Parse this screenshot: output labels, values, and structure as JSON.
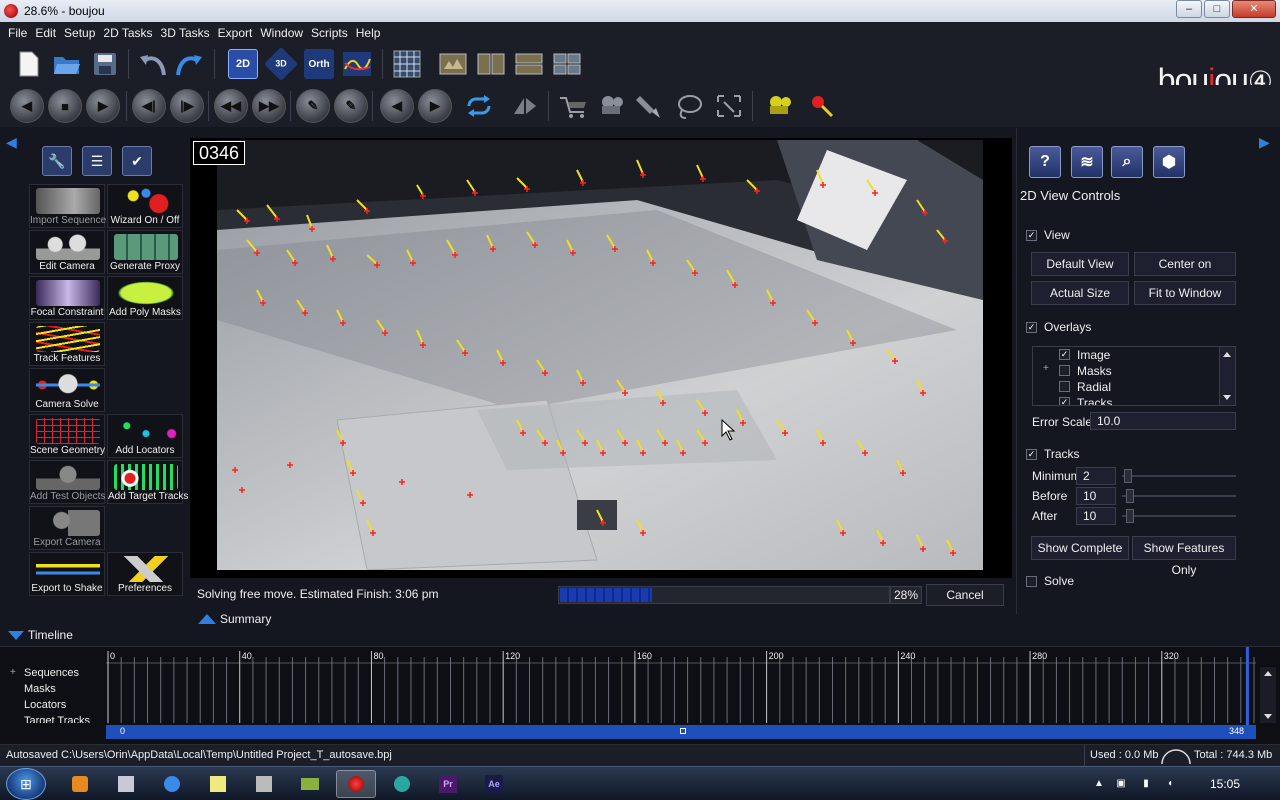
{
  "window": {
    "title": "28.6% - boujou",
    "minimize": "–",
    "maximize": "□",
    "close": "✕"
  },
  "menu": [
    "File",
    "Edit",
    "Setup",
    "2D Tasks",
    "3D Tasks",
    "Export",
    "Window",
    "Scripts",
    "Help"
  ],
  "toolbar": {
    "view_2d": "2D",
    "view_3d": "3D",
    "view_orth": "Orth"
  },
  "logo": {
    "text_a": "bou",
    "text_u": "j",
    "text_b": "ou",
    "mark": "④"
  },
  "left_tools": [
    {
      "label": "Import Sequence",
      "enabled": false
    },
    {
      "label": "Wizard On / Off",
      "enabled": true
    },
    {
      "label": "Edit Camera",
      "enabled": true
    },
    {
      "label": "Generate Proxy",
      "enabled": true
    },
    {
      "label": "Focal Constraint",
      "enabled": true
    },
    {
      "label": "Add Poly Masks",
      "enabled": true
    },
    {
      "label": "Track Features",
      "enabled": true
    },
    {
      "label": "Camera Solve",
      "enabled": true
    },
    {
      "label": "Scene Geometry",
      "enabled": true
    },
    {
      "label": "Add Locators",
      "enabled": true
    },
    {
      "label": "Add Test Objects",
      "enabled": false
    },
    {
      "label": "Add Target Tracks",
      "enabled": true
    },
    {
      "label": "Export Camera",
      "enabled": false
    },
    {
      "label": "Export to Shake",
      "enabled": true
    },
    {
      "label": "Preferences",
      "enabled": true
    }
  ],
  "viewport": {
    "frame_number": "0346"
  },
  "solve_status": {
    "text": "Solving free move. Estimated Finish: 3:06 pm",
    "progress": 0.28,
    "percent_label": "28%",
    "cancel": "Cancel"
  },
  "summary_label": "Summary",
  "right_panel": {
    "title": "2D View Controls",
    "view": {
      "label": "View",
      "checked": true
    },
    "buttons": {
      "default_view": "Default View",
      "center": "Center on selection",
      "actual_size": "Actual Size",
      "fit": "Fit to Window"
    },
    "overlays": {
      "label": "Overlays",
      "checked": true
    },
    "overlay_items": [
      {
        "label": "Image",
        "checked": true,
        "expandable": false
      },
      {
        "label": "Masks",
        "checked": false,
        "expandable": true
      },
      {
        "label": "Radial",
        "checked": false,
        "expandable": false
      },
      {
        "label": "Tracks",
        "checked": true,
        "expandable": false
      }
    ],
    "error_scale": {
      "label": "Error Scale",
      "value": "10.0"
    },
    "tracks": {
      "label": "Tracks",
      "checked": true
    },
    "sliders": [
      {
        "label": "Minimum",
        "value": "2"
      },
      {
        "label": "Before",
        "value": "10"
      },
      {
        "label": "After",
        "value": "10"
      }
    ],
    "show_complete": "Show Complete",
    "show_features": "Show Features Only",
    "solve": {
      "label": "Solve",
      "checked": false
    }
  },
  "timeline": {
    "label": "Timeline",
    "tracks": [
      "Sequences",
      "Masks",
      "Locators",
      "Target Tracks"
    ],
    "ticks": [
      "0",
      "40",
      "80",
      "120",
      "160",
      "200",
      "240",
      "280",
      "320"
    ],
    "start": "0",
    "end": "348"
  },
  "statusbar": {
    "autosave": "Autosaved C:\\Users\\Orin\\AppData\\Local\\Temp\\Untitled Project_T_autosave.bpj",
    "used": "Used : 0.0 Mb",
    "total": "Total : 744.3 Mb"
  },
  "taskbar": {
    "apps": [
      "media-player",
      "file-manager",
      "globe",
      "sticky-notes",
      "tools",
      "monitor",
      "boujou",
      "snagit",
      "premiere",
      "after-effects"
    ],
    "premiere_label": "Pr",
    "after_effects_label": "Ae",
    "clock": "15:05"
  }
}
